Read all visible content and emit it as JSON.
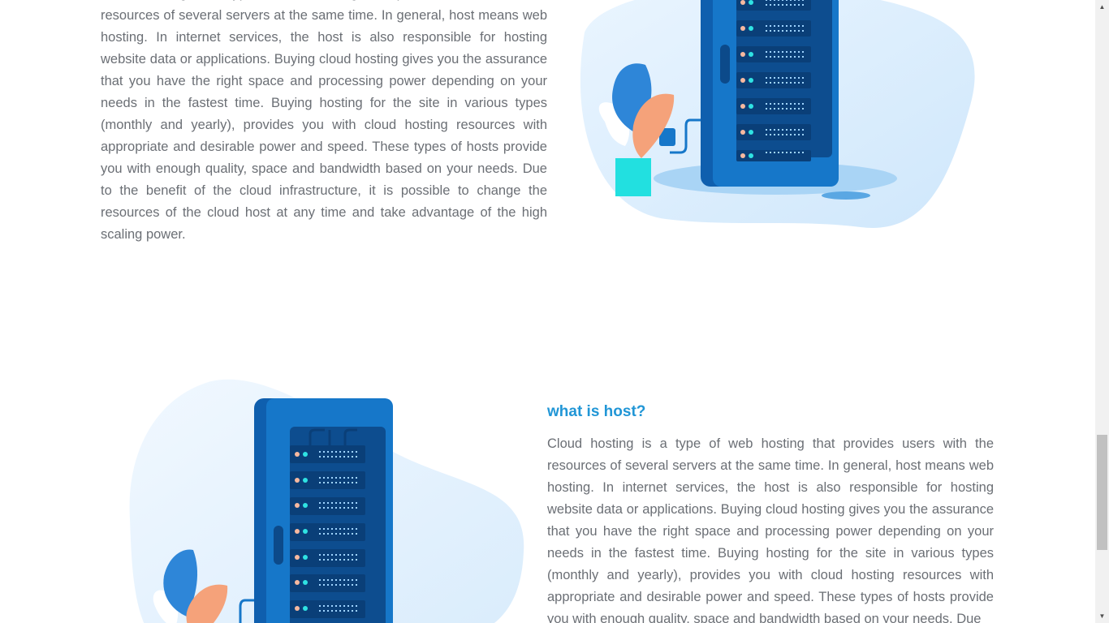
{
  "top_section": {
    "paragraph": "Cloud hosting is a type of web hosting that provides users with the resources of several servers at the same time. In general, host means web hosting. In internet services, the host is also responsible for hosting website data or applications. Buying cloud hosting gives you the assurance that you have the right space and processing power depending on your needs in the fastest time. Buying hosting for the site in various types (monthly and yearly), provides you with cloud hosting resources with appropriate and desirable power and speed. These types of hosts provide you with enough quality, space and bandwidth based on your needs. Due to the benefit of the cloud infrastructure, it is possible to change the resources of the cloud host at any time and take advantage of the high scaling power."
  },
  "bottom_section": {
    "title": "what is host?",
    "paragraph": "Cloud hosting is a type of web hosting that provides users with the resources of several servers at the same time. In general, host means web hosting. In internet services, the host is also responsible for hosting website data or applications. Buying cloud hosting gives you the assurance that you have the right space and processing power depending on your needs in the fastest time. Buying hosting for the site in various types (monthly and yearly), provides you with cloud hosting resources with appropriate and desirable power and speed. These types of hosts provide you with enough quality, space and bandwidth based on your needs. Due"
  },
  "colors": {
    "title": "#2196d6",
    "body_text": "#6b6f75",
    "server_blue": "#0f5fae",
    "blob_blue": "#dcefff",
    "leaf_orange": "#f5a27a",
    "pot_cyan": "#22e0e0"
  },
  "icons": {
    "server_illustration": "server-rack-illustration",
    "plant": "plant-illustration"
  }
}
